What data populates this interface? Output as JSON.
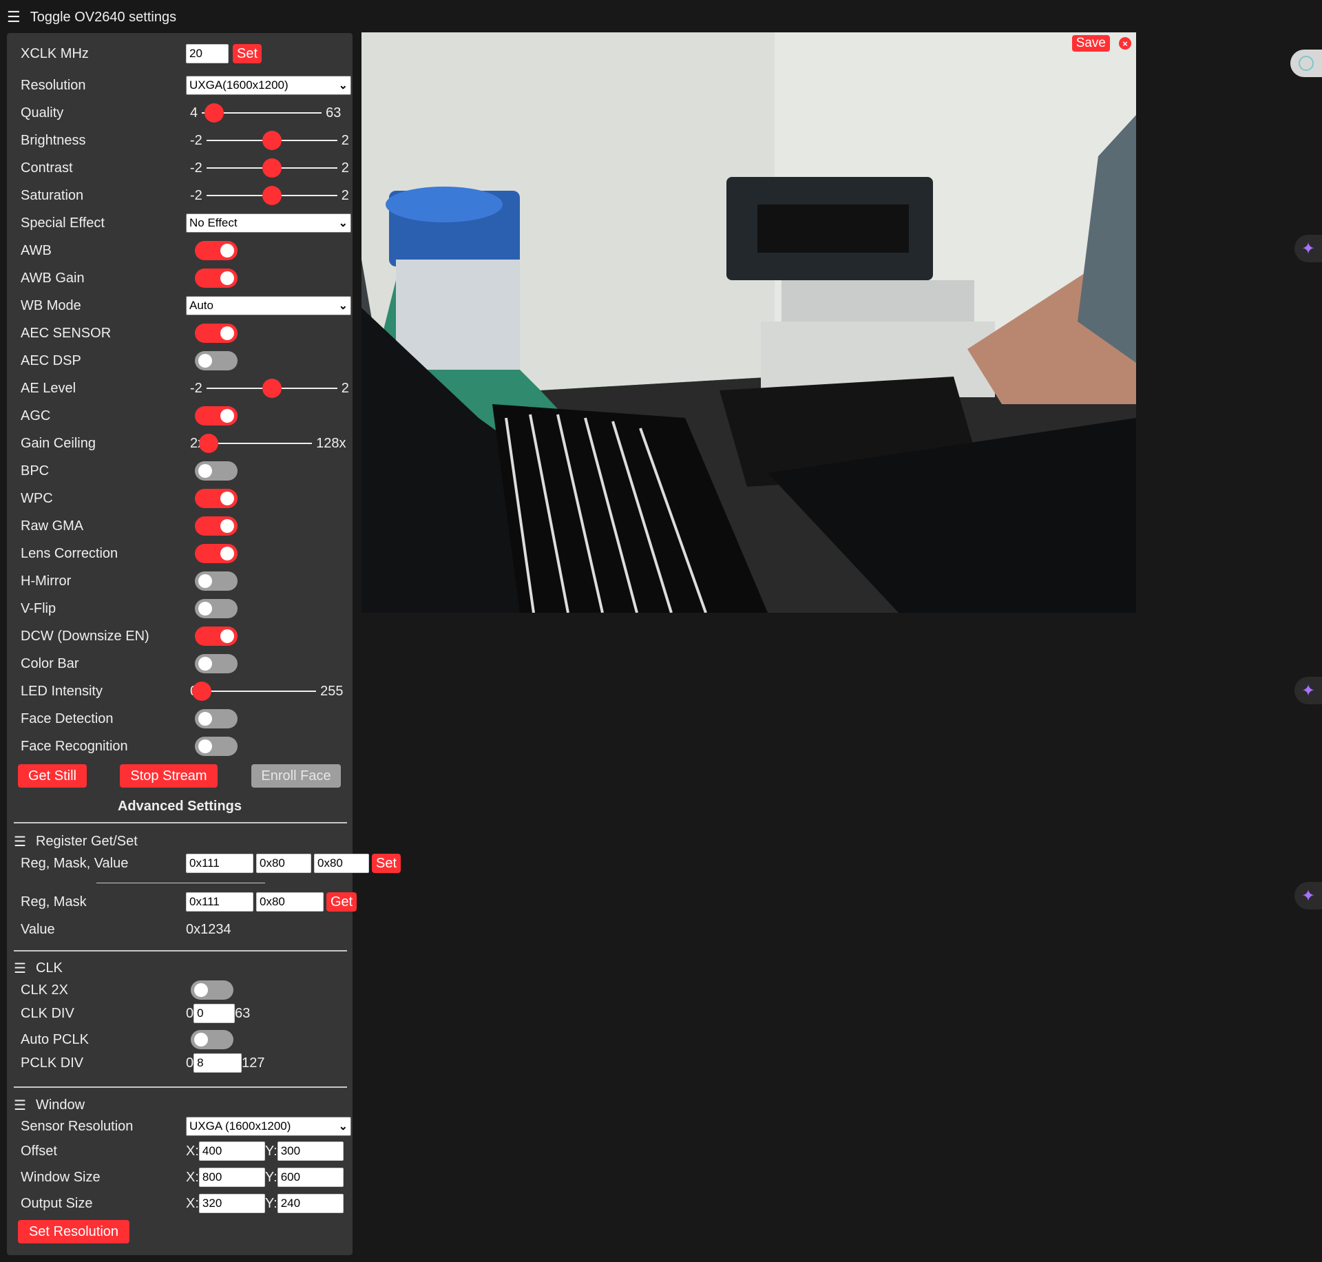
{
  "header": {
    "menu_icon": "☰",
    "title": "Toggle OV2640 settings"
  },
  "settings": {
    "xclk": {
      "label": "XCLK MHz",
      "value": "20",
      "button": "Set"
    },
    "resolution": {
      "label": "Resolution",
      "selected": "UXGA(1600x1200)"
    },
    "quality": {
      "label": "Quality",
      "min": "4",
      "max": "63",
      "value": 10
    },
    "brightness": {
      "label": "Brightness",
      "min": "-2",
      "max": "2",
      "value": 0
    },
    "contrast": {
      "label": "Contrast",
      "min": "-2",
      "max": "2",
      "value": 0
    },
    "saturation": {
      "label": "Saturation",
      "min": "-2",
      "max": "2",
      "value": 0
    },
    "special_effect": {
      "label": "Special Effect",
      "selected": "No Effect"
    },
    "awb": {
      "label": "AWB",
      "on": true
    },
    "awb_gain": {
      "label": "AWB Gain",
      "on": true
    },
    "wb_mode": {
      "label": "WB Mode",
      "selected": "Auto"
    },
    "aec_sensor": {
      "label": "AEC SENSOR",
      "on": true
    },
    "aec_dsp": {
      "label": "AEC DSP",
      "on": false
    },
    "ae_level": {
      "label": "AE Level",
      "min": "-2",
      "max": "2",
      "value": 0
    },
    "agc": {
      "label": "AGC",
      "on": true
    },
    "gain_ceiling": {
      "label": "Gain Ceiling",
      "min": "2x",
      "max": "128x",
      "value": 0
    },
    "bpc": {
      "label": "BPC",
      "on": false
    },
    "wpc": {
      "label": "WPC",
      "on": true
    },
    "raw_gma": {
      "label": "Raw GMA",
      "on": true
    },
    "lens_correction": {
      "label": "Lens Correction",
      "on": true
    },
    "h_mirror": {
      "label": "H-Mirror",
      "on": false
    },
    "v_flip": {
      "label": "V-Flip",
      "on": false
    },
    "dcw": {
      "label": "DCW (Downsize EN)",
      "on": true
    },
    "color_bar": {
      "label": "Color Bar",
      "on": false
    },
    "led_intensity": {
      "label": "LED Intensity",
      "min": "0",
      "max": "255",
      "value": 0
    },
    "face_detection": {
      "label": "Face Detection",
      "on": false
    },
    "face_recognition": {
      "label": "Face Recognition",
      "on": false
    }
  },
  "actions": {
    "get_still": "Get Still",
    "stop_stream": "Stop Stream",
    "enroll_face": "Enroll Face"
  },
  "advanced": {
    "title": "Advanced Settings",
    "register": {
      "title": "Register Get/Set",
      "set_label": "Reg, Mask, Value",
      "set_reg": "0x111",
      "set_mask": "0x80",
      "set_value": "0x80",
      "set_button": "Set",
      "get_label": "Reg, Mask",
      "get_reg": "0x111",
      "get_mask": "0x80",
      "get_button": "Get",
      "value_label": "Value",
      "value": "0x1234"
    },
    "clk": {
      "title": "CLK",
      "clk2x": {
        "label": "CLK 2X",
        "on": false
      },
      "clk_div": {
        "label": "CLK DIV",
        "min": "0",
        "value": "0",
        "max": "63"
      },
      "auto_pclk": {
        "label": "Auto PCLK",
        "on": false
      },
      "pclk_div": {
        "label": "PCLK DIV",
        "min": "0",
        "value": "8",
        "max": "127"
      }
    },
    "window": {
      "title": "Window",
      "sensor_resolution": {
        "label": "Sensor Resolution",
        "selected": "UXGA (1600x1200)"
      },
      "offset": {
        "label": "Offset",
        "x": "400",
        "y": "300"
      },
      "window_size": {
        "label": "Window Size",
        "x": "800",
        "y": "600"
      },
      "output_size": {
        "label": "Output Size",
        "x": "320",
        "y": "240"
      },
      "x_label": "X:",
      "y_label": "Y:",
      "button": "Set Resolution"
    }
  },
  "stream": {
    "save": "Save",
    "close": "×"
  },
  "side_tools": {
    "icon": "✦"
  },
  "colors": {
    "accent": "#ff3034",
    "panel": "#363636",
    "background": "#181818",
    "switch_off": "#9e9e9e"
  }
}
